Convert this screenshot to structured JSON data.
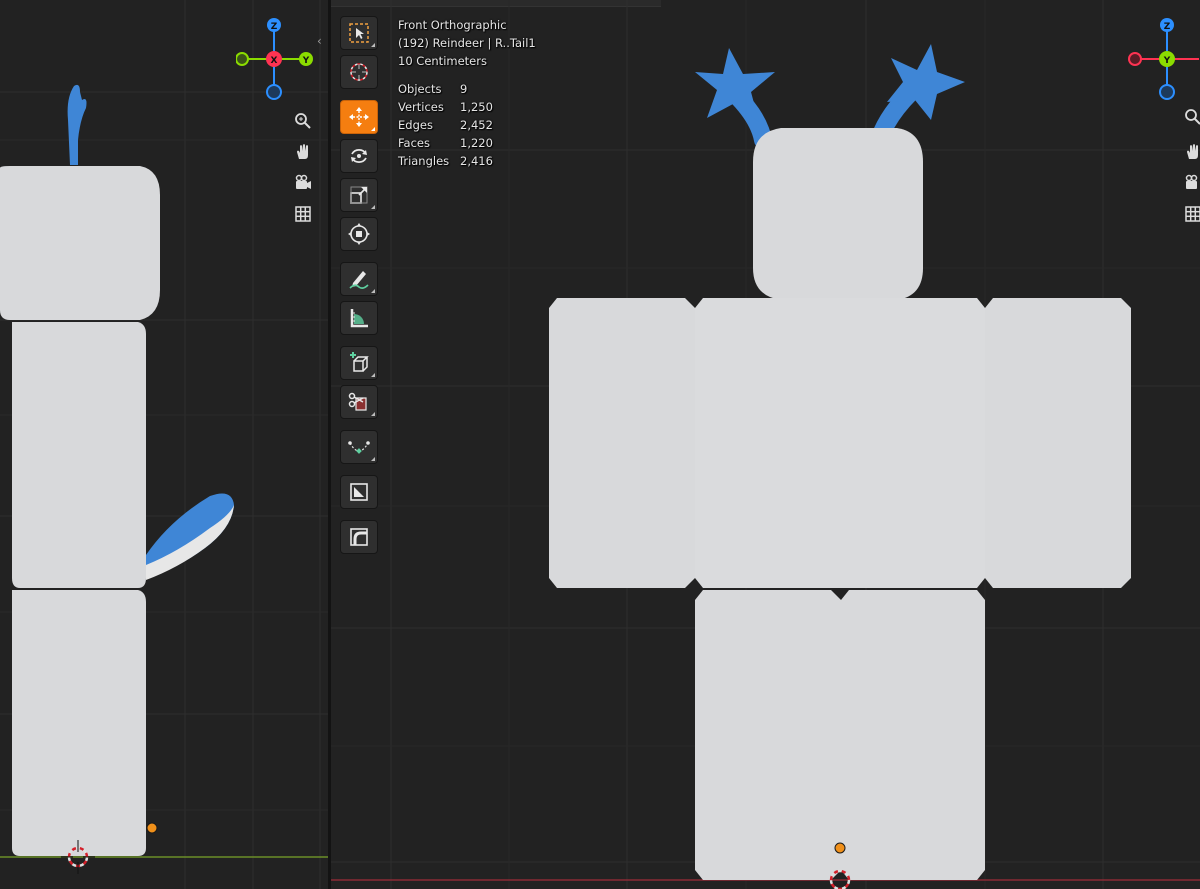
{
  "viewport_left": {
    "gizmo": {
      "center_label": "X",
      "top_label": "Z",
      "right_label": "Y"
    },
    "nav_icons": [
      "zoom-icon",
      "hand-pan-icon",
      "camera-icon",
      "grid-icon"
    ]
  },
  "viewport_right": {
    "view_name": "Front Orthographic",
    "object_info": "(192) Reindeer | R..Tail1",
    "scale": "10 Centimeters",
    "stats": [
      {
        "label": "Objects",
        "value": "9"
      },
      {
        "label": "Vertices",
        "value": "1,250"
      },
      {
        "label": "Edges",
        "value": "2,452"
      },
      {
        "label": "Faces",
        "value": "1,220"
      },
      {
        "label": "Triangles",
        "value": "2,416"
      }
    ],
    "gizmo": {
      "center_label": "Y",
      "top_label": "Z"
    },
    "toolbar": [
      {
        "name": "select-box-tool",
        "active": false
      },
      {
        "name": "cursor-tool",
        "active": false
      },
      {
        "name": "move-tool",
        "active": true
      },
      {
        "name": "rotate-tool",
        "active": false
      },
      {
        "name": "scale-tool",
        "active": false
      },
      {
        "name": "transform-tool",
        "active": false
      },
      {
        "name": "annotate-tool",
        "active": false
      },
      {
        "name": "measure-tool",
        "active": false
      },
      {
        "name": "add-cube-tool",
        "active": false
      },
      {
        "name": "knife-tool",
        "active": false
      },
      {
        "name": "curve-tool",
        "active": false
      },
      {
        "name": "shear-tool",
        "active": false
      },
      {
        "name": "bevel-tool",
        "active": false
      }
    ]
  },
  "colors": {
    "active_tool": "#f57e10",
    "axis_x": "#ff3352",
    "axis_y": "#8bdc00",
    "axis_z": "#2c8fff",
    "model_body": "#d9dadc",
    "model_accent": "#3f86d6"
  }
}
